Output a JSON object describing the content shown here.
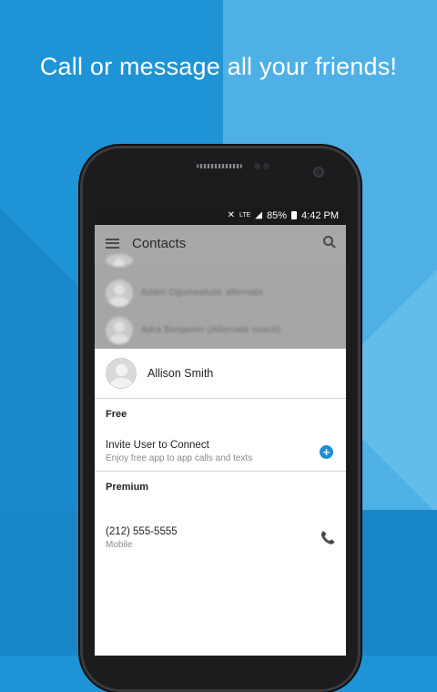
{
  "headline": "Call or message all your friends!",
  "status_bar": {
    "mute_icon": "mute-icon",
    "network": "LTE",
    "signal_icon": "signal-icon",
    "battery": "85%",
    "time": "4:42 PM"
  },
  "app_bar": {
    "menu_icon": "menu-icon",
    "title": "Contacts",
    "search_icon": "search-icon"
  },
  "background_contacts": [
    {
      "name": "Adam Ogunwalude alternate"
    },
    {
      "name": "Adra Benjamin (Alternate coach)"
    }
  ],
  "selected_contact": {
    "name": "Allison Smith"
  },
  "sections": {
    "free": {
      "header": "Free",
      "title": "Invite User to Connect",
      "subtitle": "Enjoy free app to app calls and texts"
    },
    "premium": {
      "header": "Premium",
      "number": "(212) 555-5555",
      "label": "Mobile"
    }
  },
  "colors": {
    "accent": "#1b8fd6",
    "background_left": "#1e94d6",
    "background_right": "#4fb0e6"
  }
}
